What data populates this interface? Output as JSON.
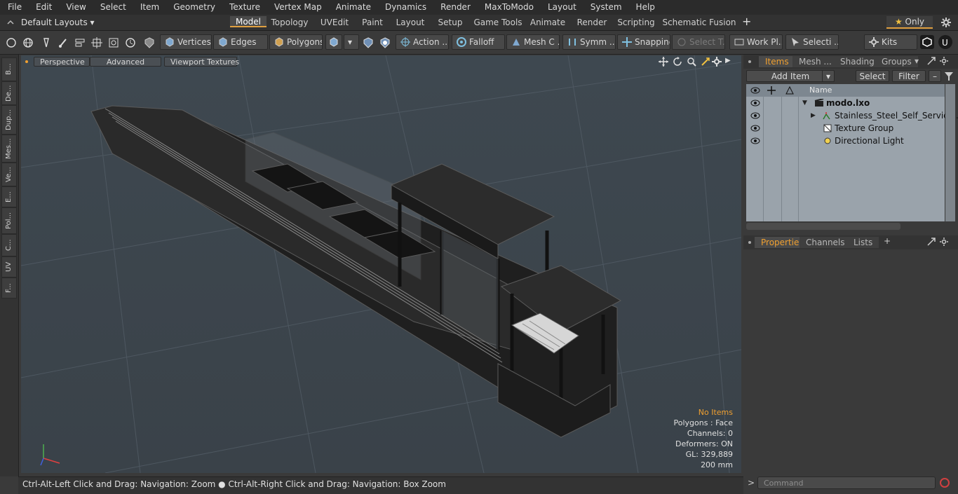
{
  "menu": [
    "File",
    "Edit",
    "View",
    "Select",
    "Item",
    "Geometry",
    "Texture",
    "Vertex Map",
    "Animate",
    "Dynamics",
    "Render",
    "MaxToModo",
    "Layout",
    "System",
    "Help"
  ],
  "layouts": {
    "selector": "Default Layouts",
    "only_label": "Only"
  },
  "layout_tabs": [
    "Model",
    "Topology",
    "UVEdit",
    "Paint",
    "Layout",
    "Setup",
    "Game Tools",
    "Animate",
    "Render",
    "Scripting",
    "Schematic Fusion"
  ],
  "active_layout_tab": "Model",
  "toolbar": {
    "vertices": "Vertices",
    "edges": "Edges",
    "polygons": "Polygons",
    "action": "Action ...",
    "falloff": "Falloff",
    "mesh": "Mesh C ...",
    "symm": "Symm ...",
    "snapping": "Snapping",
    "select_t": "Select T...",
    "work_pl": "Work Pl...",
    "selecti": "Selecti ...",
    "kits": "Kits"
  },
  "left_tabs": [
    "B...",
    "De...",
    "Dup...",
    "Mes...",
    "Ve...",
    "E...",
    "Pol...",
    "C...",
    "UV",
    "F..."
  ],
  "viewport": {
    "buttons": [
      "Perspective",
      "Advanced",
      "Viewport Textures"
    ],
    "info": {
      "no_items": "No Items",
      "polygons": "Polygons : Face",
      "channels": "Channels: 0",
      "deformers": "Deformers: ON",
      "gl": "GL: 329,889",
      "units": "200 mm"
    },
    "highlight_color": "#f0a030"
  },
  "status": "Ctrl-Alt-Left Click and Drag: Navigation: Zoom ● Ctrl-Alt-Right Click and Drag: Navigation: Box Zoom",
  "items_panel": {
    "tabs": [
      "Items",
      "Mesh ...",
      "Shading",
      "Groups"
    ],
    "add_item": "Add Item",
    "select": "Select",
    "filter": "Filter",
    "column_name": "Name",
    "rows": [
      {
        "name": "modo.lxo"
      },
      {
        "name": "Stainless_Steel_Self_Service ..."
      },
      {
        "name": "Texture Group"
      },
      {
        "name": "Directional Light"
      }
    ]
  },
  "properties_panel": {
    "tabs": [
      "Properties",
      "Channels",
      "Lists"
    ]
  },
  "command": {
    "placeholder": "Command"
  }
}
